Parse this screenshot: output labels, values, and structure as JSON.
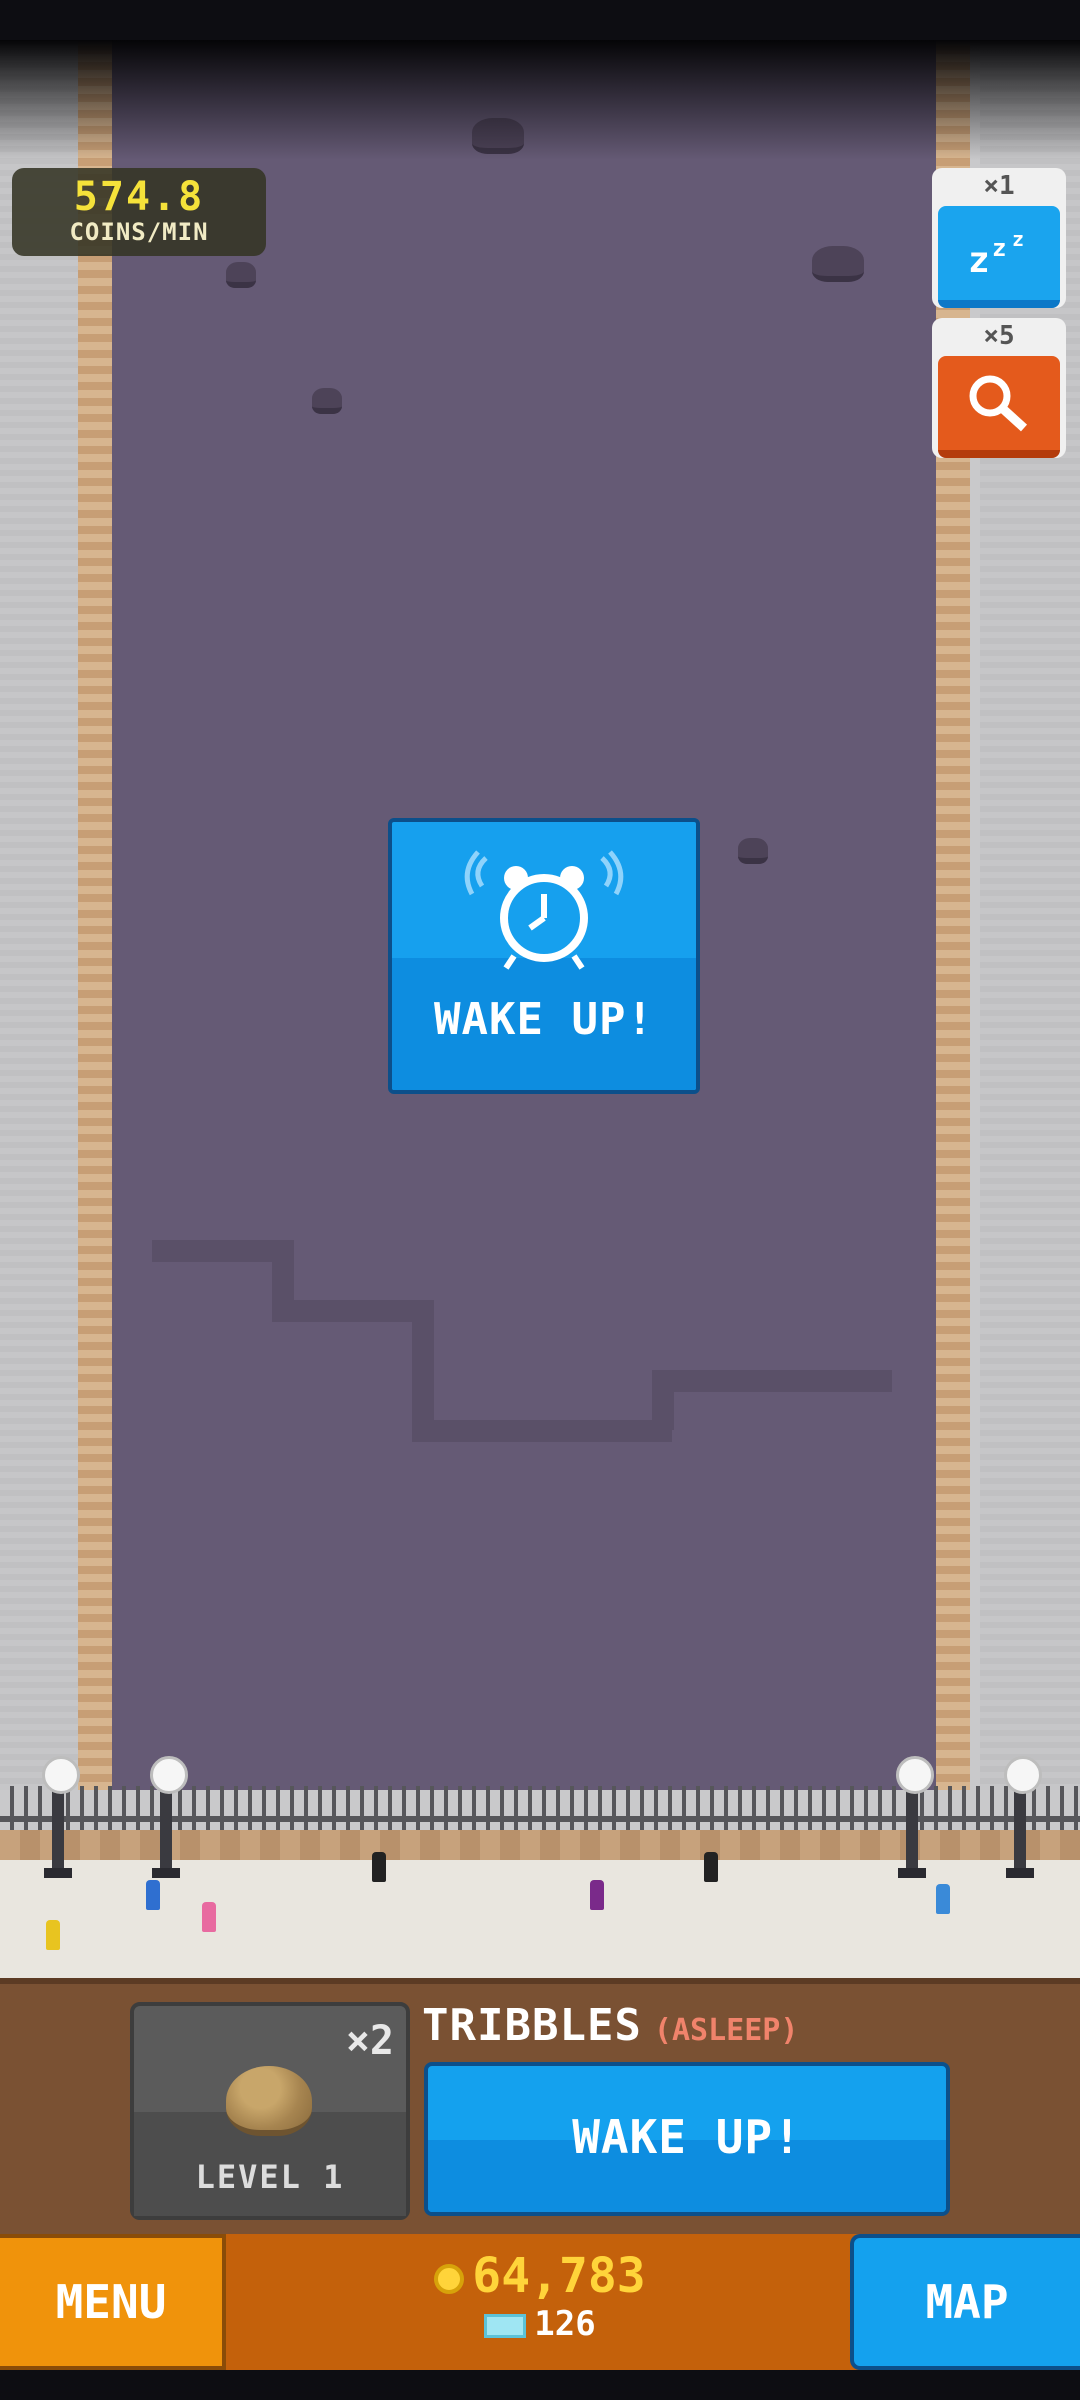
{
  "hud": {
    "coins_per_min_value": "574.8",
    "coins_per_min_label": "COINS/MIN"
  },
  "powerups": [
    {
      "count": "×1",
      "icon": "sleep-zzz-icon",
      "color": "#1aa4ee"
    },
    {
      "count": "×5",
      "icon": "magnifier-icon",
      "color": "#e45a1c"
    }
  ],
  "center_prompt": {
    "icon": "alarm-clock-icon",
    "label": "WAKE UP!"
  },
  "pet": {
    "multiplier": "×2",
    "level": "LEVEL 1",
    "name": "TRIBBLES",
    "status": "(ASLEEP)",
    "action_label": "WAKE UP!"
  },
  "nav": {
    "menu_label": "MENU",
    "map_label": "MAP",
    "coins": "64,783",
    "gems": "126"
  },
  "colors": {
    "accent_blue": "#14a1ee",
    "accent_orange": "#f0930b",
    "coin_yellow": "#ffd43a",
    "status_red": "#f0836b"
  }
}
